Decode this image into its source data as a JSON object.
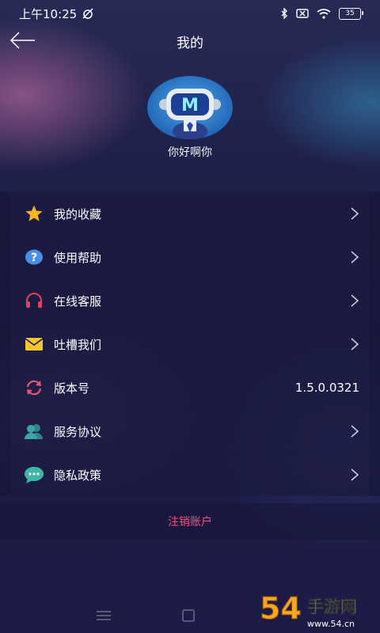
{
  "status_bar": {
    "time": "上午10:25",
    "battery": "35"
  },
  "header": {
    "title": "我的"
  },
  "profile": {
    "avatar_letter": "M",
    "nickname": "你好啊你"
  },
  "menu": {
    "items": [
      {
        "label": "我的收藏",
        "icon": "star-icon"
      },
      {
        "label": "使用帮助",
        "icon": "help-icon"
      },
      {
        "label": "在线客服",
        "icon": "headphones-icon"
      },
      {
        "label": "吐槽我们",
        "icon": "mail-icon"
      },
      {
        "label": "版本号",
        "icon": "refresh-icon",
        "value": "1.5.0.0321"
      },
      {
        "label": "服务协议",
        "icon": "users-icon"
      },
      {
        "label": "隐私政策",
        "icon": "chat-icon"
      }
    ]
  },
  "logout": {
    "label": "注销账户"
  },
  "watermark": {
    "number": "54",
    "text": "手游网",
    "domain": "www.54.cn"
  },
  "colors": {
    "logout": "#ff4f7b",
    "star": "#f7b52a",
    "help": "#4a8ee6",
    "headphones": "#e0435c",
    "mail": "#f5c531",
    "refresh": "#e8557a",
    "users": "#3aa7a0",
    "chat": "#3db7a4"
  }
}
